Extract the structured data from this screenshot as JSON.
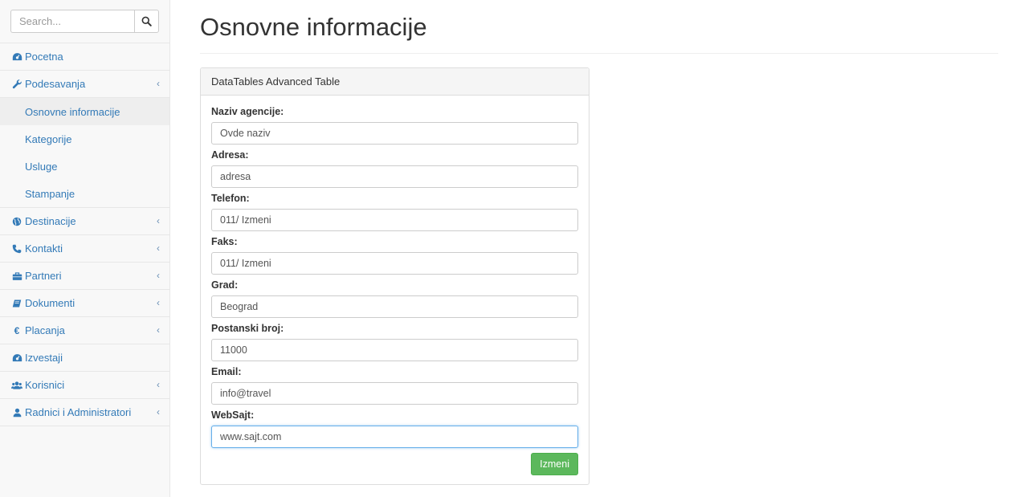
{
  "search": {
    "placeholder": "Search...",
    "icon": "search-icon"
  },
  "sidebar": {
    "items": [
      {
        "label": "Pocetna",
        "icon": "dashboard-icon"
      },
      {
        "label": "Podesavanja",
        "icon": "wrench-icon",
        "caret": "‹",
        "children": [
          {
            "label": "Osnovne informacije",
            "active": true
          },
          {
            "label": "Kategorije"
          },
          {
            "label": "Usluge"
          },
          {
            "label": "Stampanje"
          }
        ]
      },
      {
        "label": "Destinacije",
        "icon": "globe-icon",
        "caret": "‹"
      },
      {
        "label": "Kontakti",
        "icon": "phone-icon",
        "caret": "‹"
      },
      {
        "label": "Partneri",
        "icon": "briefcase-icon",
        "caret": "‹"
      },
      {
        "label": "Dokumenti",
        "icon": "book-icon",
        "caret": "‹"
      },
      {
        "label": "Placanja",
        "icon": "euro-icon",
        "caret": "‹"
      },
      {
        "label": "Izvestaji",
        "icon": "dashboard-icon"
      },
      {
        "label": "Korisnici",
        "icon": "users-icon",
        "caret": "‹"
      },
      {
        "label": "Radnici i Administratori",
        "icon": "user-icon",
        "caret": "‹"
      }
    ]
  },
  "main": {
    "title": "Osnovne informacije",
    "panel": {
      "heading": "DataTables Advanced Table",
      "fields": [
        {
          "label": "Naziv agencije:",
          "value": "Ovde naziv"
        },
        {
          "label": "Adresa:",
          "value": "adresa"
        },
        {
          "label": "Telefon:",
          "value": "011/ Izmeni"
        },
        {
          "label": "Faks:",
          "value": "011/ Izmeni"
        },
        {
          "label": "Grad:",
          "value": "Beograd"
        },
        {
          "label": "Postanski broj:",
          "value": "11000"
        },
        {
          "label": "Email:",
          "value": "info@travel"
        },
        {
          "label": "WebSajt:",
          "value": "www.sajt.com"
        }
      ],
      "submit_label": "Izmeni"
    }
  },
  "colors": {
    "link": "#337ab7",
    "success": "#5cb85c",
    "focus_border": "#66afe9"
  }
}
